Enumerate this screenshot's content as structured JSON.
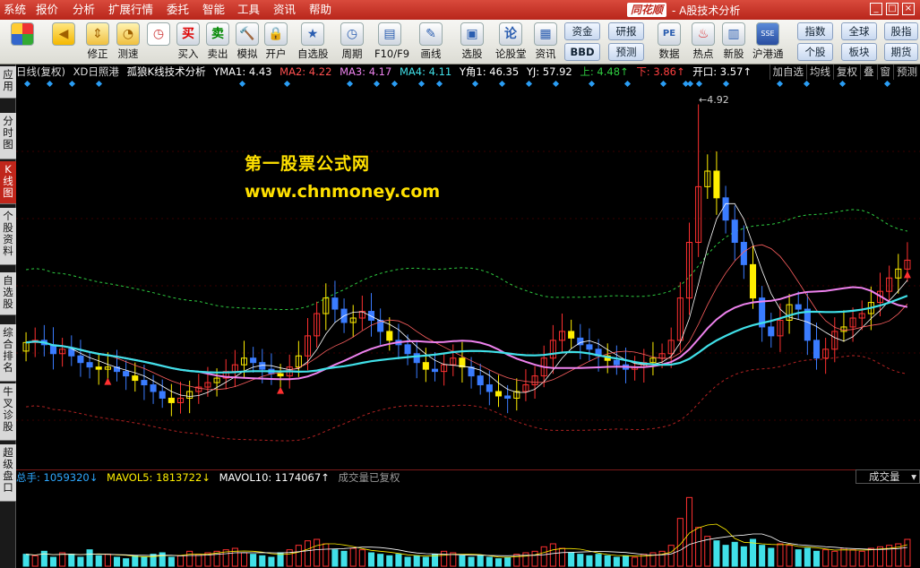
{
  "menu": {
    "items": [
      "系统",
      "报价",
      "分析",
      "扩展行情",
      "委托",
      "智能",
      "工具",
      "资讯",
      "帮助"
    ]
  },
  "brand": {
    "logo": "同花顺",
    "title": "- A股技术分析"
  },
  "toolbar": {
    "buttons": [
      {
        "label": "",
        "icon": "grid-icon"
      },
      {
        "label": "",
        "icon": "back-arrow-icon"
      },
      {
        "label": "修正",
        "icon": "up-down-arrows-icon"
      },
      {
        "label": "测速",
        "icon": "speed-icon"
      },
      {
        "label": "买入",
        "icon": "buy-icon",
        "glyph": "买"
      },
      {
        "label": "卖出",
        "icon": "sell-icon",
        "glyph": "卖"
      },
      {
        "label": "模拟",
        "icon": "gavel-icon"
      },
      {
        "label": "开户",
        "icon": "lock-icon"
      },
      {
        "label": "自选股",
        "icon": "star-icon"
      },
      {
        "label": "周期",
        "icon": "clock-icon"
      },
      {
        "label": "F10/F9",
        "icon": "screen-icon"
      },
      {
        "label": "画线",
        "icon": "pen-icon"
      },
      {
        "label": "选股",
        "icon": "monitor-icon"
      },
      {
        "label": "论股堂",
        "icon": "forum-icon",
        "glyph": "论"
      },
      {
        "label": "资讯",
        "icon": "doc-icon"
      },
      {
        "label": "数据",
        "icon": "pe-icon",
        "glyph": "PE"
      },
      {
        "label": "热点",
        "icon": "hot-icon"
      },
      {
        "label": "新股",
        "icon": "new-stock-icon"
      },
      {
        "label": "沪港通",
        "icon": "sse-hkex-icon",
        "glyph": "SSE"
      }
    ],
    "small_buttons": [
      "资金",
      "BBD",
      "研报",
      "预测",
      "指数",
      "个股",
      "全球",
      "板块",
      "股指",
      "期货"
    ]
  },
  "sidebar": {
    "tabs": [
      "应用",
      "分时图",
      "K线图",
      "个股资料",
      "自选股",
      "综合排名",
      "牛叉诊股",
      "超级盘口"
    ],
    "active": "K线图"
  },
  "info": {
    "period": "日线(复权)",
    "stock": "XD日照港",
    "formula": "孤狼K线技术分析",
    "ma1": "YMA1: 4.43",
    "ma2": "MA2: 4.22",
    "ma3": "MA3: 4.17",
    "ma4": "MA4: 4.11",
    "yangle": "Y角1: 46.35",
    "yj": "YJ: 57.92",
    "up": "上: 4.48↑",
    "down": "下: 3.86↑",
    "open": "开口: 3.57↑",
    "tabs": [
      "加自选",
      "均线",
      "复权",
      "叠",
      "窗",
      "预测"
    ]
  },
  "watermark": {
    "line1": "第一股票公式网",
    "line2": "www.chnmoney.com"
  },
  "max_label": "4.92",
  "volume": {
    "total": "总手: 1059320↓",
    "mavol5": "MAVOL5: 1813722↓",
    "mavol10": "MAVOL10: 1174067↑",
    "note": "成交量已复权",
    "dropdown": "成交量"
  },
  "colors": {
    "up": "#ff3030",
    "down": "#3a7cff",
    "yellow": "#ffee00",
    "cyan": "#40e0e8",
    "pink": "#ee82ee",
    "green_dash": "#2ecc40",
    "red_dash": "#b22222",
    "accent": "#c0261b"
  },
  "chart_data": {
    "type": "candlestick",
    "price_range": [
      3.3,
      4.95
    ],
    "max_price": 4.92,
    "closes": [
      3.85,
      3.86,
      3.84,
      3.8,
      3.82,
      3.79,
      3.76,
      3.74,
      3.73,
      3.74,
      3.72,
      3.7,
      3.68,
      3.66,
      3.63,
      3.6,
      3.58,
      3.6,
      3.63,
      3.65,
      3.67,
      3.69,
      3.72,
      3.75,
      3.78,
      3.76,
      3.73,
      3.71,
      3.7,
      3.74,
      3.79,
      3.88,
      3.98,
      4.05,
      4.0,
      3.94,
      3.96,
      3.99,
      3.95,
      3.9,
      3.86,
      3.84,
      3.8,
      3.76,
      3.73,
      3.72,
      3.75,
      3.78,
      3.74,
      3.7,
      3.66,
      3.63,
      3.61,
      3.6,
      3.63,
      3.66,
      3.7,
      3.78,
      3.86,
      3.9,
      3.87,
      3.84,
      3.82,
      3.79,
      3.77,
      3.75,
      3.73,
      3.74,
      3.76,
      3.78,
      3.8,
      3.86,
      4.05,
      4.3,
      4.55,
      4.62,
      4.5,
      4.4,
      4.3,
      4.2,
      4.05,
      3.92,
      3.88,
      3.95,
      4.02,
      4.0,
      3.86,
      3.78,
      3.82,
      3.9,
      3.92,
      3.96,
      3.98,
      4.03,
      4.08,
      4.14,
      4.18,
      4.22
    ],
    "volumes": [
      0.4,
      0.35,
      0.5,
      0.3,
      0.45,
      0.4,
      0.3,
      0.55,
      0.35,
      0.4,
      0.3,
      0.25,
      0.35,
      0.3,
      0.4,
      0.45,
      0.3,
      0.35,
      0.5,
      0.4,
      0.45,
      0.5,
      0.55,
      0.6,
      0.45,
      0.4,
      0.35,
      0.3,
      0.45,
      0.55,
      0.7,
      0.85,
      0.9,
      0.75,
      0.55,
      0.5,
      0.6,
      0.55,
      0.45,
      0.4,
      0.35,
      0.4,
      0.3,
      0.35,
      0.3,
      0.4,
      0.5,
      0.45,
      0.35,
      0.3,
      0.35,
      0.3,
      0.25,
      0.3,
      0.4,
      0.45,
      0.5,
      0.65,
      0.75,
      0.6,
      0.45,
      0.4,
      0.35,
      0.4,
      0.35,
      0.3,
      0.35,
      0.3,
      0.4,
      0.45,
      0.5,
      0.7,
      1.6,
      2.3,
      1.3,
      1.0,
      0.85,
      0.7,
      0.8,
      0.65,
      0.9,
      0.7,
      0.6,
      0.75,
      0.7,
      0.55,
      0.6,
      0.5,
      0.55,
      0.5,
      0.6,
      0.55,
      0.5,
      0.6,
      0.65,
      0.7,
      0.75,
      0.9
    ]
  }
}
